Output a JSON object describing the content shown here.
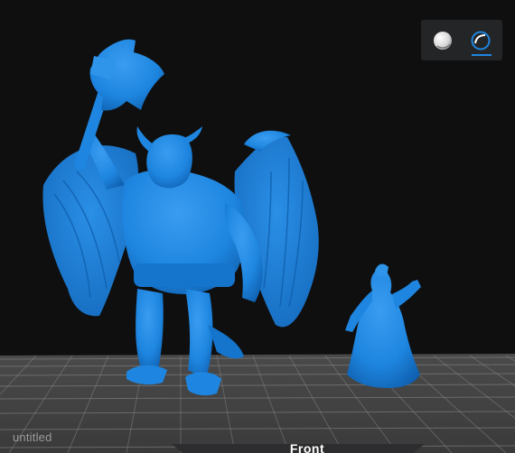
{
  "document": {
    "title": "untitled"
  },
  "view_toolbar": {
    "shaded_icon": "shaded-sphere-icon",
    "xray_icon": "xray-sphere-icon",
    "active_mode": "xray"
  },
  "view_cube": {
    "front_label": "Front"
  },
  "scene": {
    "model_color": "#1e86e0",
    "background_color": "#0f0f10",
    "grid_color": "#8c8c8c",
    "models": [
      "winged-demon-miniature",
      "robed-sorcerer-miniature"
    ]
  }
}
